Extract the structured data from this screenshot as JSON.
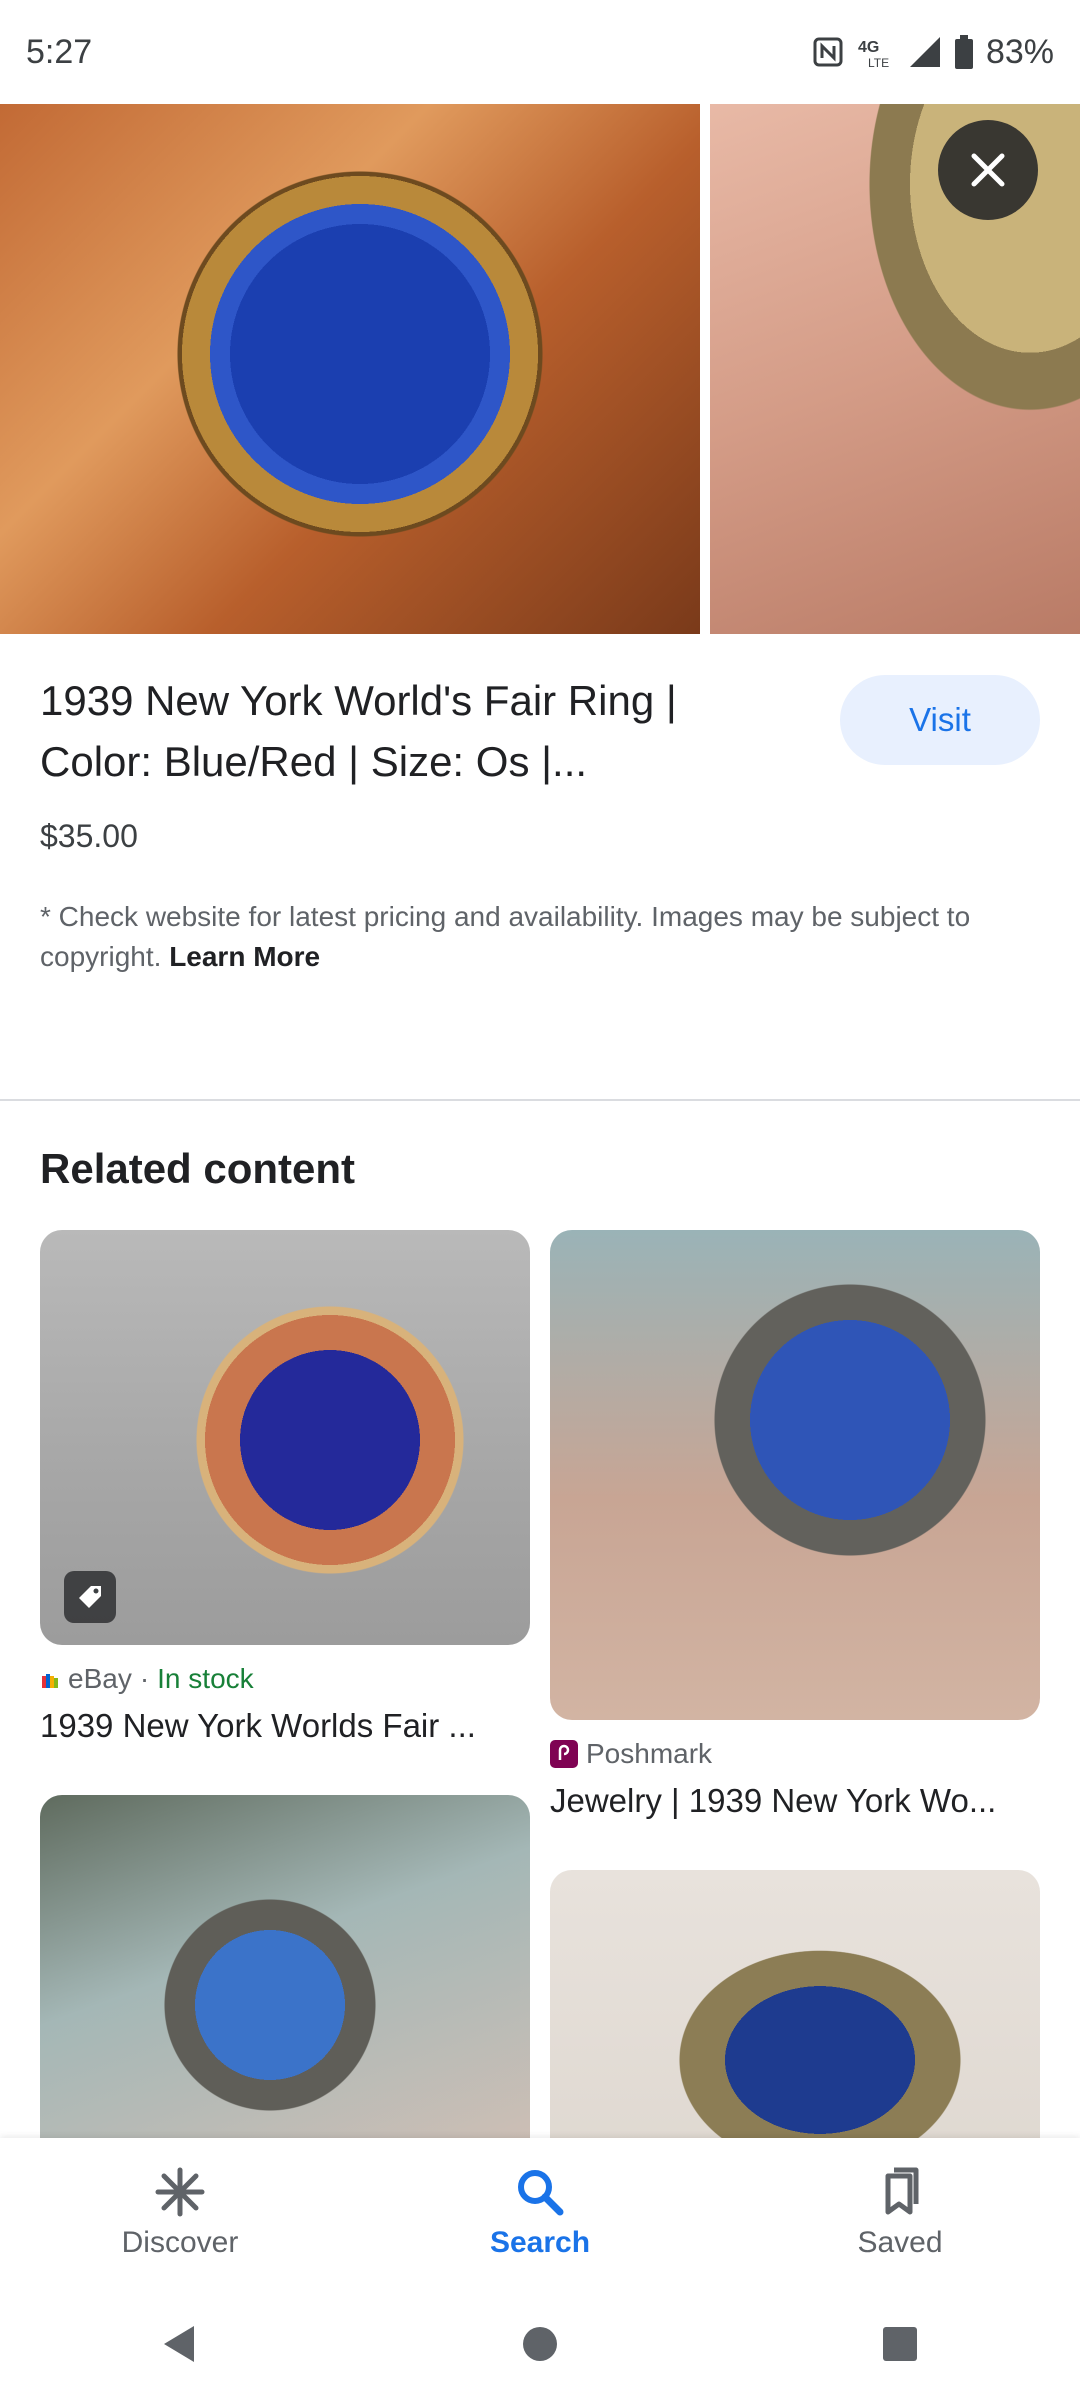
{
  "status_bar": {
    "time": "5:27",
    "network": "4G LTE",
    "battery_text": "83%",
    "icons": [
      "nfc-icon",
      "lte-icon",
      "signal-icon",
      "battery-icon"
    ]
  },
  "product": {
    "title": "1939 New York World's Fair Ring | Color: Blue/Red | Size: Os |...",
    "visit_label": "Visit",
    "price": "$35.00",
    "disclaimer": "* Check website for latest pricing and availability. Images may be subject to copyright.",
    "learn_more": "Learn More"
  },
  "related": {
    "heading": "Related content",
    "items": [
      {
        "source": "eBay",
        "stock": "In stock",
        "title": "1939 New York Worlds Fair ..."
      },
      {
        "source": "Poshmark",
        "title": "Jewelry | 1939 New York Wo..."
      }
    ]
  },
  "bottom_nav": {
    "items": [
      {
        "label": "Discover",
        "icon": "asterisk-icon"
      },
      {
        "label": "Search",
        "icon": "search-icon",
        "active": true
      },
      {
        "label": "Saved",
        "icon": "bookmarks-icon"
      }
    ]
  },
  "colors": {
    "accent": "#1a73e8",
    "visit_bg": "#e8f0fe",
    "in_stock": "#188038",
    "text_primary": "#202124",
    "text_secondary": "#5f6368"
  }
}
